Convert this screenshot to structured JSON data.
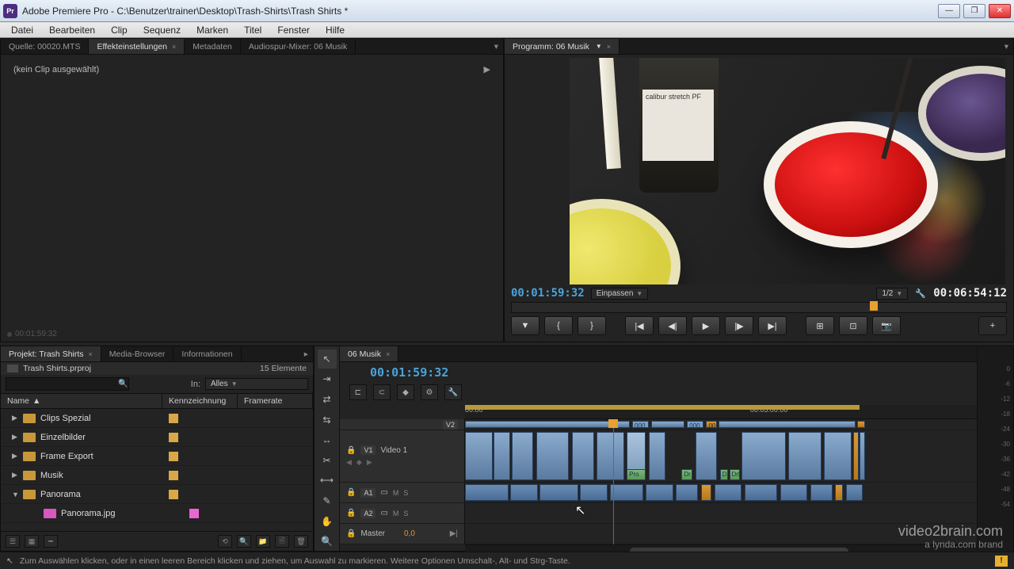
{
  "window": {
    "app_icon": "Pr",
    "title": "Adobe Premiere Pro - C:\\Benutzer\\trainer\\Desktop\\Trash-Shirts\\Trash Shirts *"
  },
  "menu": [
    "Datei",
    "Bearbeiten",
    "Clip",
    "Sequenz",
    "Marken",
    "Titel",
    "Fenster",
    "Hilfe"
  ],
  "source_panel": {
    "tabs": [
      "Quelle: 00020.MTS",
      "Effekteinstellungen",
      "Metadaten",
      "Audiospur-Mixer: 06 Musik"
    ],
    "active_tab": 1,
    "no_clip": "(kein Clip ausgewählt)",
    "tc_small": "00:01:59:32"
  },
  "program_panel": {
    "tab": "Programm: 06 Musik",
    "tc_current": "00:01:59:32",
    "fit_label": "Einpassen",
    "scale_label": "1/2",
    "tc_duration": "00:06:54:12",
    "bottle_text": "calibur\nstretch\nPF"
  },
  "project_panel": {
    "tabs": [
      "Projekt: Trash Shirts",
      "Media-Browser",
      "Informationen"
    ],
    "active_tab": 0,
    "project_file": "Trash Shirts.prproj",
    "element_count": "15 Elemente",
    "search_placeholder": "",
    "in_label": "In:",
    "in_value": "Alles",
    "columns": {
      "name": "Name",
      "label": "Kennzeichnung",
      "rate": "Framerate"
    },
    "items": [
      {
        "name": "Clips Spezial",
        "type": "bin",
        "expanded": false
      },
      {
        "name": "Einzelbilder",
        "type": "bin",
        "expanded": false
      },
      {
        "name": "Frame Export",
        "type": "bin",
        "expanded": false
      },
      {
        "name": "Musik",
        "type": "bin",
        "expanded": false
      },
      {
        "name": "Panorama",
        "type": "bin",
        "expanded": true
      },
      {
        "name": "Panorama.jpg",
        "type": "image",
        "child": true
      }
    ]
  },
  "timeline_panel": {
    "tab": "06 Musik",
    "tc": "00:01:59:32",
    "ruler_ticks": [
      {
        "pos": 0,
        "label": "00:00"
      },
      {
        "pos": 52,
        "label": "00:05:00:00"
      }
    ],
    "tracks": {
      "v2_short": "V2",
      "v1": {
        "id": "V1",
        "name": "Video 1"
      },
      "a1": {
        "id": "A1"
      },
      "a2": {
        "id": "A2"
      },
      "master": {
        "name": "Master",
        "value": "0,0"
      }
    },
    "clip_labels": {
      "ooo": "000",
      "oo": "00",
      "pro": "Pro",
      "dr": "Dr",
      "drl": "Drl"
    }
  },
  "audio_meter": {
    "marks": [
      "0",
      "-6",
      "-12",
      "-18",
      "-24",
      "-30",
      "-36",
      "-42",
      "-48",
      "-54"
    ]
  },
  "statusbar": {
    "text": "Zum Auswählen klicken, oder in einen leeren Bereich klicken und ziehen, um Auswahl zu markieren. Weitere Optionen Umschalt-, Alt- und Strg-Taste."
  },
  "watermark": {
    "line1": "video2brain.com",
    "line2": "a lynda.com brand"
  },
  "transport_glyphs": [
    "▼",
    "{",
    "}",
    "|◀",
    "◀|",
    "▶",
    "|▶",
    "▶|",
    "⊞",
    "⊡",
    "📷"
  ]
}
